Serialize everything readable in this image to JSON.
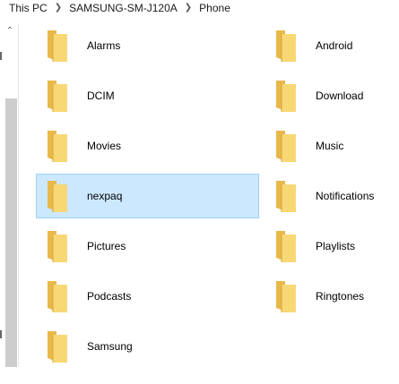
{
  "breadcrumb": {
    "items": [
      "This PC",
      "SAMSUNG-SM-J120A",
      "Phone"
    ]
  },
  "folders": {
    "left": [
      "Alarms",
      "DCIM",
      "Movies",
      "nexpaq",
      "Pictures",
      "Podcasts",
      "Samsung"
    ],
    "right": [
      "Android",
      "Download",
      "Music",
      "Notifications",
      "Playlists",
      "Ringtones"
    ],
    "selected": "nexpaq"
  },
  "icons": {
    "folder": "folder-icon",
    "separator": "chevron-right-icon",
    "scroll_up": "chevron-up-icon"
  },
  "colors": {
    "selection_fill": "#cce8ff",
    "selection_border": "#99d1ff",
    "folder_body": "#f8d775",
    "folder_back": "#e8b84a"
  }
}
